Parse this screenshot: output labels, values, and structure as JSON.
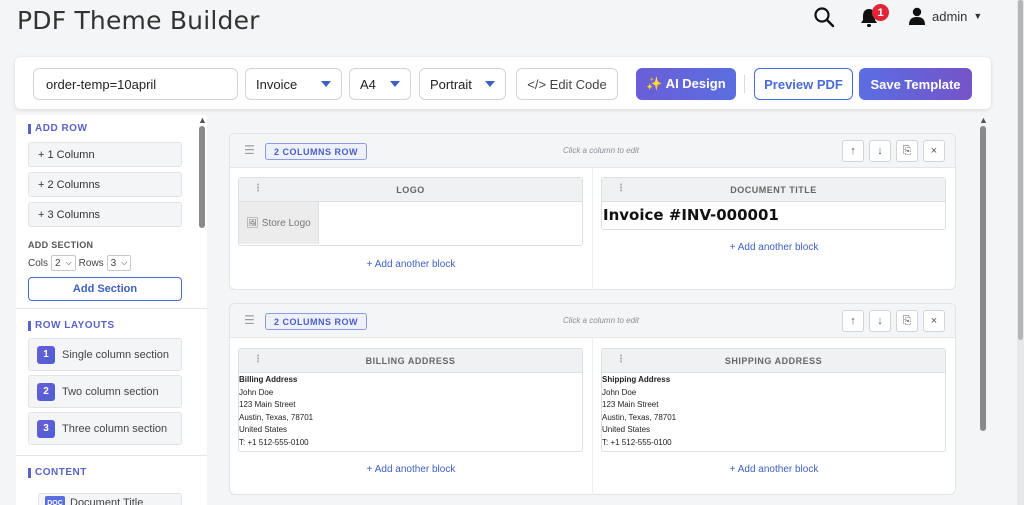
{
  "header": {
    "title": "PDF Theme Builder",
    "notification_count": "1",
    "user_name": "admin"
  },
  "toolbar": {
    "template_name": "order-temp=10april",
    "doc_type": "Invoice",
    "paper_size": "A4",
    "orientation": "Portrait",
    "edit_code_label": "</> Edit Code",
    "ai_design_label": "✨ AI Design",
    "preview_label": "Preview PDF",
    "save_label": "Save Template"
  },
  "sidebar": {
    "add_row_head": "ADD ROW",
    "add_row_items": [
      "+ 1 Column",
      "+ 2 Columns",
      "+ 3 Columns"
    ],
    "add_section_head": "ADD SECTION",
    "cols_label": "Cols",
    "cols_value": "2",
    "rows_label": "Rows",
    "rows_value": "3",
    "add_section_button": "Add Section",
    "row_layouts_head": "ROW LAYOUTS",
    "layouts": [
      {
        "num": "1",
        "label": "Single column section"
      },
      {
        "num": "2",
        "label": "Two column section"
      },
      {
        "num": "3",
        "label": "Three column section"
      }
    ],
    "content_head": "CONTENT",
    "content_items": [
      {
        "badge": "DOC",
        "label": "Document Title"
      }
    ]
  },
  "canvas": {
    "rows": [
      {
        "tag": "2 COLUMNS ROW",
        "hint": "Click a column to edit",
        "columns": [
          {
            "block_title": "LOGO",
            "logo_placeholder": "🖼 Store Logo",
            "add_label": "+ Add another block"
          },
          {
            "block_title": "DOCUMENT TITLE",
            "title_text": "Invoice #INV-000001",
            "add_label": "+ Add another block"
          }
        ]
      },
      {
        "tag": "2 COLUMNS ROW",
        "hint": "Click a column to edit",
        "columns": [
          {
            "block_title": "BILLING ADDRESS",
            "address": {
              "heading": "Billing Address",
              "lines": [
                "John Doe",
                "123 Main Street",
                "Austin, Texas, 78701",
                "United States",
                "T: +1 512-555-0100"
              ]
            },
            "add_label": "+ Add another block"
          },
          {
            "block_title": "SHIPPING ADDRESS",
            "address": {
              "heading": "Shipping Address",
              "lines": [
                "John Doe",
                "123 Main Street",
                "Austin, Texas, 78701",
                "United States",
                "T: +1 512-555-0100"
              ]
            },
            "add_label": "+ Add another block"
          }
        ]
      }
    ]
  },
  "colors": {
    "accent": "#5a63c9",
    "primary_button": "#5b6ee0",
    "badge_red": "#e0243a"
  }
}
